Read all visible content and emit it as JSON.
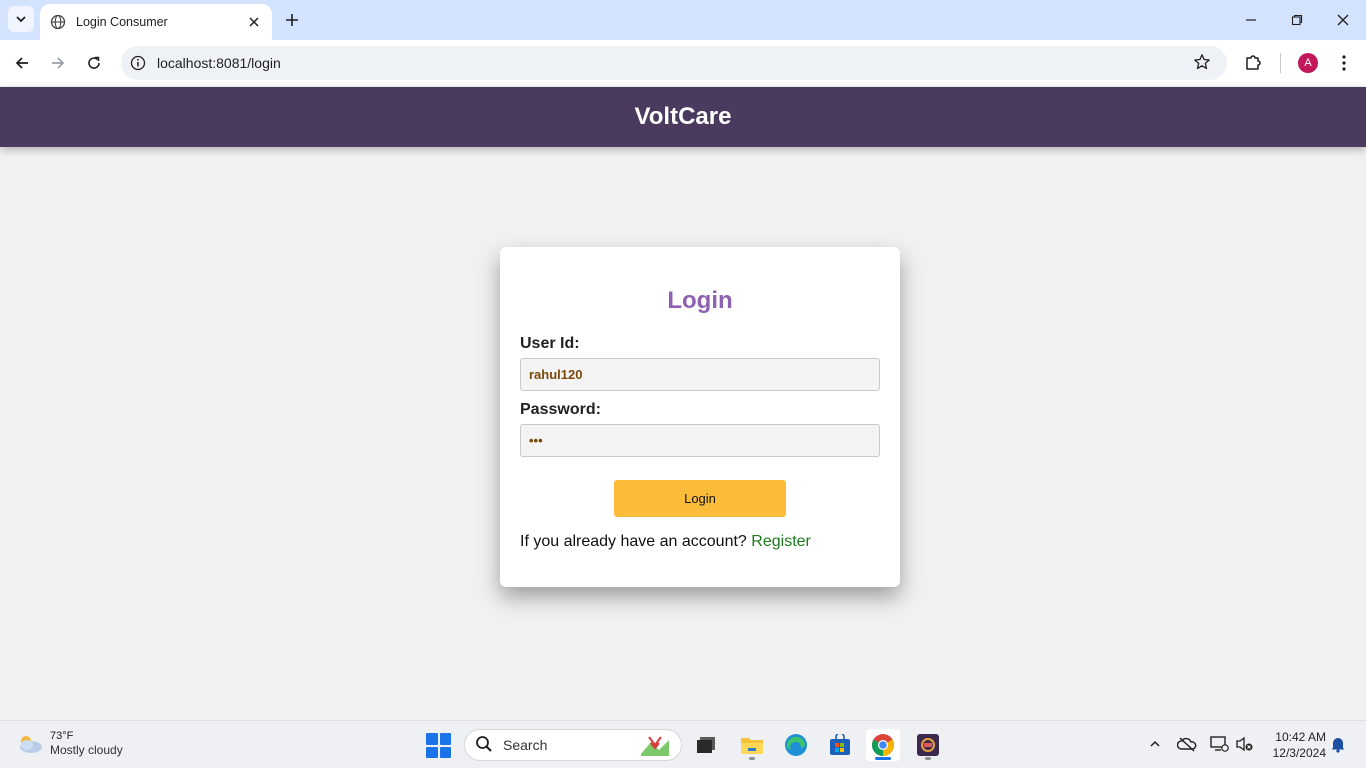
{
  "browser": {
    "tab_title": "Login Consumer",
    "url": "localhost:8081/login",
    "profile_initial": "A"
  },
  "header": {
    "brand": "VoltCare"
  },
  "login": {
    "title": "Login",
    "user_id_label": "User Id:",
    "user_id_value": "rahul120",
    "password_label": "Password:",
    "password_value": "•••",
    "button_label": "Login",
    "register_prompt": "If you already have an account?",
    "register_link": "Register"
  },
  "taskbar": {
    "weather_temp": "73°F",
    "weather_condition": "Mostly cloudy",
    "search_placeholder": "Search",
    "time": "10:42 AM",
    "date": "12/3/2024"
  },
  "colors": {
    "header_bg": "#4a3a5e",
    "title": "#8e62b0",
    "button": "#fbbc3a",
    "link": "#1d7a1d"
  }
}
